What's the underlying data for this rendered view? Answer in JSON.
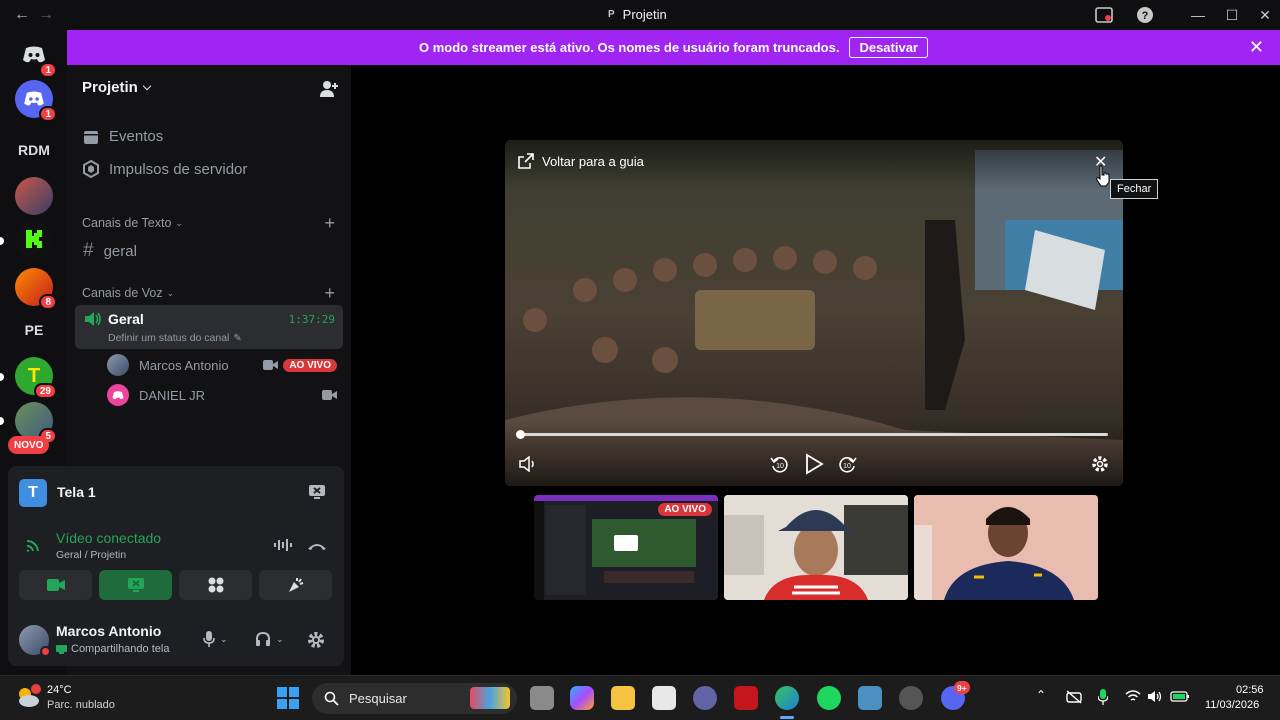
{
  "window": {
    "title": "Projetin",
    "icon_letter": "P"
  },
  "banner": {
    "message": "O modo streamer está ativo. Os nomes de usuário foram truncados.",
    "button_label": "Desativar"
  },
  "rail": {
    "items": [
      {
        "label": "",
        "badge": "1"
      },
      {
        "label": "",
        "badge": "1"
      },
      {
        "label": "RDM",
        "badge": ""
      },
      {
        "label": "",
        "badge": ""
      },
      {
        "label": "",
        "badge": ""
      },
      {
        "label": "",
        "badge": "8"
      },
      {
        "label": "PE",
        "badge": ""
      },
      {
        "label": "",
        "badge": "29"
      },
      {
        "label": "",
        "badge": "5"
      }
    ],
    "new_label": "NOVO"
  },
  "sidebar": {
    "server_name": "Projetin",
    "events_label": "Eventos",
    "boosts_label": "Impulsos de servidor",
    "text_category": "Canais de Texto",
    "text_channel": "geral",
    "voice_category": "Canais de Voz",
    "voice_channel": {
      "name": "Geral",
      "timer": "1:37:29",
      "status_placeholder": "Definir um status do canal",
      "users": [
        {
          "name": "Marcos Antonio",
          "badge": "AO VIVO"
        },
        {
          "name": "DANIEL JR",
          "badge": ""
        }
      ]
    }
  },
  "screen_panel": {
    "title": "Tela 1",
    "connection_status": "Vídeo conectado",
    "connection_location": "Geral / Projetin"
  },
  "user_panel": {
    "name": "Marcos Antonio",
    "status": "Compartilhando tela"
  },
  "player": {
    "back_label": "Voltar para a guia",
    "progress": 0.0
  },
  "tiles": [
    {
      "kind": "screen",
      "badge": "AO VIVO"
    },
    {
      "kind": "camera",
      "badge": ""
    },
    {
      "kind": "camera",
      "badge": ""
    }
  ],
  "tooltip": "Fechar",
  "taskbar": {
    "weather_temp": "24°C",
    "weather_desc": "Parc. nublado",
    "search_placeholder": "Pesquisar",
    "time": "02:56",
    "date": "11/03/2026",
    "discord_badge": "9+"
  },
  "colors": {
    "banner": "#a125f2",
    "live": "#da373c",
    "green": "#23a55a",
    "sidebar": "#121214"
  }
}
